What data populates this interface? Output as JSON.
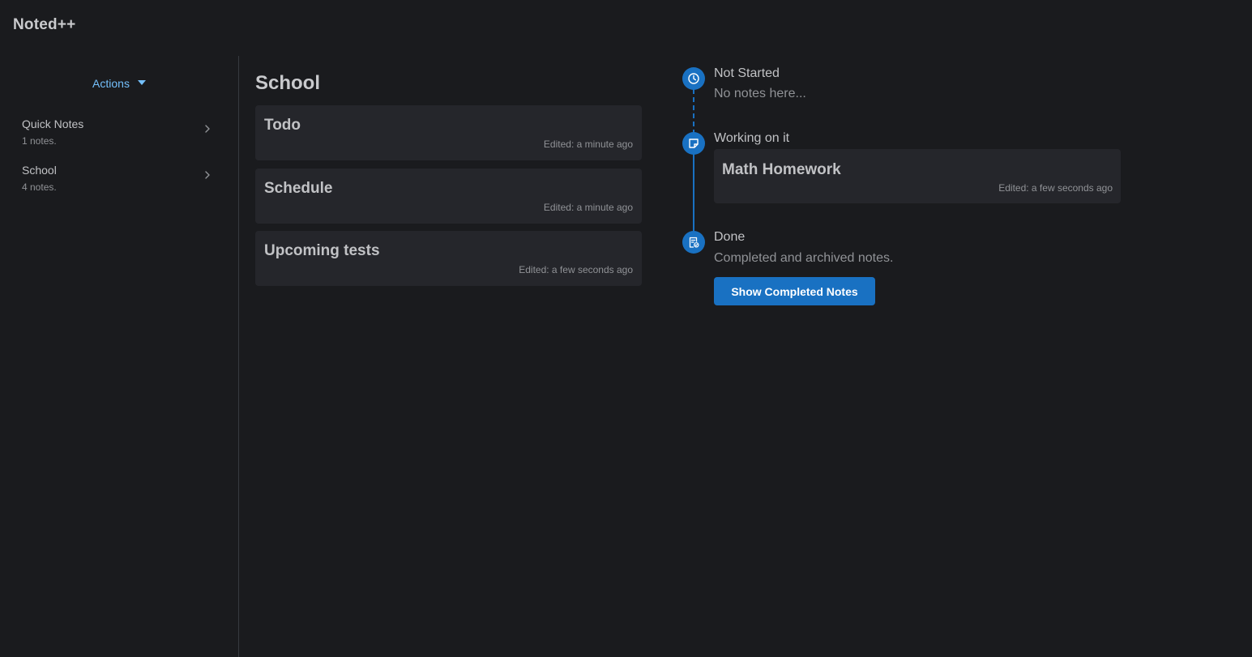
{
  "app": {
    "title": "Noted++"
  },
  "sidebar": {
    "actions_label": "Actions",
    "items": [
      {
        "label": "Quick Notes",
        "count": "1 notes."
      },
      {
        "label": "School",
        "count": "4 notes."
      }
    ]
  },
  "main": {
    "title": "School",
    "notes": [
      {
        "title": "Todo",
        "edited": "Edited: a minute ago"
      },
      {
        "title": "Schedule",
        "edited": "Edited: a minute ago"
      },
      {
        "title": "Upcoming tests",
        "edited": "Edited: a few seconds ago"
      }
    ]
  },
  "timeline": {
    "stages": [
      {
        "title": "Not Started",
        "description": "No notes here...",
        "icon": "clock-icon"
      },
      {
        "title": "Working on it",
        "icon": "note-icon",
        "notes": [
          {
            "title": "Math Homework",
            "edited": "Edited: a few seconds ago"
          }
        ]
      },
      {
        "title": "Done",
        "description": "Completed and archived notes.",
        "icon": "report-check-icon",
        "button_label": "Show Completed Notes"
      }
    ]
  },
  "colors": {
    "background": "#1a1b1e",
    "card": "#25262b",
    "accent": "#1971c2",
    "link": "#74c0fc",
    "text": "#c1c2c5",
    "dimmed": "#909296"
  }
}
